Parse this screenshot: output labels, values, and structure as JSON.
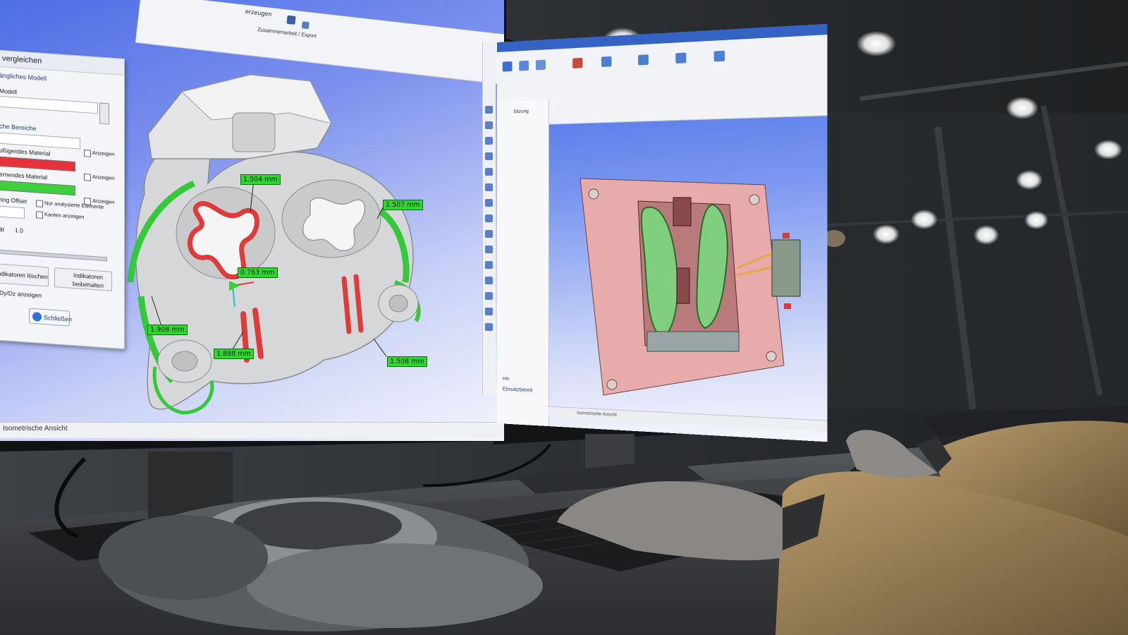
{
  "left_screen": {
    "ribbon": {
      "top_label": "erzeugen",
      "group_label": "Zusammenarbeit / Export"
    },
    "compare_dialog": {
      "title": "vergleichen",
      "section_model": "ängliches Modell",
      "model_label": "Modell",
      "section_areas": "che Bereiche",
      "add_material_label": "ufügendes Material",
      "remove_material_label": "ernendes Material",
      "show_label": "Anzeigen",
      "offset_label": "ring Offset",
      "only_analyzed": "Nur analysierte Elemente",
      "show_edges": "Kanten anzeigen",
      "value_prefix": "ät",
      "value": "1.0",
      "delete_indicators": "ndikatoren löschen",
      "keep_indicators": "Indikatoren beibehalten",
      "show_dydz": "Dy/Dz anzeigen",
      "close_button": "Schließen",
      "add_color": "#e8323b",
      "remove_color": "#3ecf3e"
    },
    "measurements": [
      "1.504 mm",
      "1.507 mm",
      "0.763 mm",
      "1.908 mm",
      "1.888 mm",
      "1.508 mm"
    ],
    "status_text": "Isometrische Ansicht",
    "viewport_gradient_top": "#4e6ee6",
    "viewport_gradient_bottom": "#f4f5fb"
  },
  "right_screen": {
    "tree_title": "Sitzung",
    "tree_caption_1": "Info",
    "tree_caption_2": "Einsatzbereit",
    "status_text": "Isometrische Ansicht",
    "mold_plate_color": "#e4a8a8",
    "mold_insert_color": "#7fcf7f"
  }
}
